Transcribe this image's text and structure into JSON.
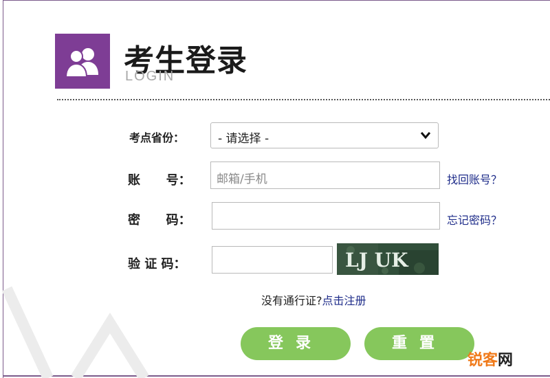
{
  "brand": {
    "title": "考生登录",
    "subtitle": "LOGIN",
    "logo_icon": "users-icon",
    "accent_color": "#7e3d95"
  },
  "form": {
    "province_label": "考点省份：",
    "province_value": "- 请选择 -",
    "account_label": "账      号：",
    "account_placeholder": "邮箱/手机",
    "account_value": "",
    "password_label": "密      码：",
    "password_value": "",
    "captcha_label": "验 证 码：",
    "captcha_value": "",
    "captcha_text": "LJ UK"
  },
  "links": {
    "recover_account": "找回账号？",
    "forgot_password": "忘记密码？",
    "register_prompt": "没有通行证?",
    "register_link": "点击注册"
  },
  "buttons": {
    "login": "登录",
    "reset": "重置",
    "button_color": "#86c75c"
  },
  "watermark": {
    "part1": "锐客",
    "part2": "网"
  }
}
